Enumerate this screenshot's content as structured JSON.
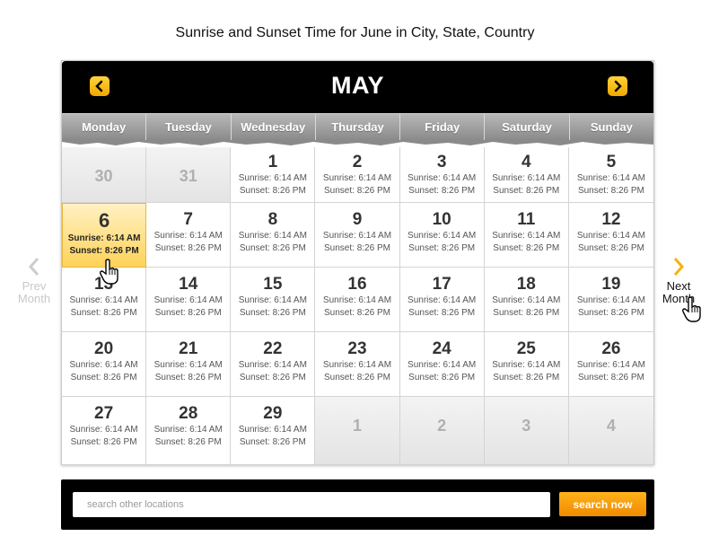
{
  "page": {
    "title": "Sunrise and Sunset Time for June in City, State, Country"
  },
  "calendar": {
    "month": "MAY",
    "weekdays": [
      "Monday",
      "Tuesday",
      "Wednesday",
      "Thursday",
      "Friday",
      "Saturday",
      "Sunday"
    ],
    "rows": [
      [
        {
          "day": "30",
          "muted": true
        },
        {
          "day": "31",
          "muted": true
        },
        {
          "day": "1",
          "sunrise": "Sunrise: 6:14 AM",
          "sunset": "Sunset: 8:26 PM"
        },
        {
          "day": "2",
          "sunrise": "Sunrise: 6:14 AM",
          "sunset": "Sunset: 8:26 PM"
        },
        {
          "day": "3",
          "sunrise": "Sunrise: 6:14 AM",
          "sunset": "Sunset: 8:26 PM"
        },
        {
          "day": "4",
          "sunrise": "Sunrise: 6:14 AM",
          "sunset": "Sunset: 8:26 PM"
        },
        {
          "day": "5",
          "sunrise": "Sunrise: 6:14 AM",
          "sunset": "Sunset: 8:26 PM"
        }
      ],
      [
        {
          "day": "6",
          "sunrise": "Sunrise: 6:14 AM",
          "sunset": "Sunset: 8:26 PM",
          "today": true
        },
        {
          "day": "7",
          "sunrise": "Sunrise: 6:14 AM",
          "sunset": "Sunset: 8:26 PM"
        },
        {
          "day": "8",
          "sunrise": "Sunrise: 6:14 AM",
          "sunset": "Sunset: 8:26 PM"
        },
        {
          "day": "9",
          "sunrise": "Sunrise: 6:14 AM",
          "sunset": "Sunset: 8:26 PM"
        },
        {
          "day": "10",
          "sunrise": "Sunrise: 6:14 AM",
          "sunset": "Sunset: 8:26 PM"
        },
        {
          "day": "11",
          "sunrise": "Sunrise: 6:14 AM",
          "sunset": "Sunset: 8:26 PM"
        },
        {
          "day": "12",
          "sunrise": "Sunrise: 6:14 AM",
          "sunset": "Sunset: 8:26 PM"
        }
      ],
      [
        {
          "day": "13",
          "sunrise": "Sunrise: 6:14 AM",
          "sunset": "Sunset: 8:26 PM"
        },
        {
          "day": "14",
          "sunrise": "Sunrise: 6:14 AM",
          "sunset": "Sunset: 8:26 PM"
        },
        {
          "day": "15",
          "sunrise": "Sunrise: 6:14 AM",
          "sunset": "Sunset: 8:26 PM"
        },
        {
          "day": "16",
          "sunrise": "Sunrise: 6:14 AM",
          "sunset": "Sunset: 8:26 PM"
        },
        {
          "day": "17",
          "sunrise": "Sunrise: 6:14 AM",
          "sunset": "Sunset: 8:26 PM"
        },
        {
          "day": "18",
          "sunrise": "Sunrise: 6:14 AM",
          "sunset": "Sunset: 8:26 PM"
        },
        {
          "day": "19",
          "sunrise": "Sunrise: 6:14 AM",
          "sunset": "Sunset: 8:26 PM"
        }
      ],
      [
        {
          "day": "20",
          "sunrise": "Sunrise: 6:14 AM",
          "sunset": "Sunset: 8:26 PM"
        },
        {
          "day": "21",
          "sunrise": "Sunrise: 6:14 AM",
          "sunset": "Sunset: 8:26 PM"
        },
        {
          "day": "22",
          "sunrise": "Sunrise: 6:14 AM",
          "sunset": "Sunset: 8:26 PM"
        },
        {
          "day": "23",
          "sunrise": "Sunrise: 6:14 AM",
          "sunset": "Sunset: 8:26 PM"
        },
        {
          "day": "24",
          "sunrise": "Sunrise: 6:14 AM",
          "sunset": "Sunset: 8:26 PM"
        },
        {
          "day": "25",
          "sunrise": "Sunrise: 6:14 AM",
          "sunset": "Sunset: 8:26 PM"
        },
        {
          "day": "26",
          "sunrise": "Sunrise: 6:14 AM",
          "sunset": "Sunset: 8:26 PM"
        }
      ],
      [
        {
          "day": "27",
          "sunrise": "Sunrise: 6:14 AM",
          "sunset": "Sunset: 8:26 PM"
        },
        {
          "day": "28",
          "sunrise": "Sunrise: 6:14 AM",
          "sunset": "Sunset: 8:26 PM"
        },
        {
          "day": "29",
          "sunrise": "Sunrise: 6:14 AM",
          "sunset": "Sunset: 8:26 PM"
        },
        {
          "day": "1",
          "muted": true
        },
        {
          "day": "2",
          "muted": true
        },
        {
          "day": "3",
          "muted": true
        },
        {
          "day": "4",
          "muted": true
        }
      ]
    ]
  },
  "nav": {
    "prev_line1": "Prev",
    "prev_line2": "Month",
    "next_line1": "Next",
    "next_line2": "Month"
  },
  "search": {
    "placeholder": "search other locations",
    "button_label": "search now"
  },
  "icons": {
    "header_prev": "chevron-left-icon",
    "header_next": "chevron-right-icon",
    "side_prev": "chevron-left-icon",
    "side_next": "chevron-right-icon",
    "cursor": "hand-pointer-icon"
  },
  "colors": {
    "accent": "#f5b400",
    "header_bg": "#000000",
    "today_bg": "#ffd35a",
    "search_button": "#f59500"
  }
}
